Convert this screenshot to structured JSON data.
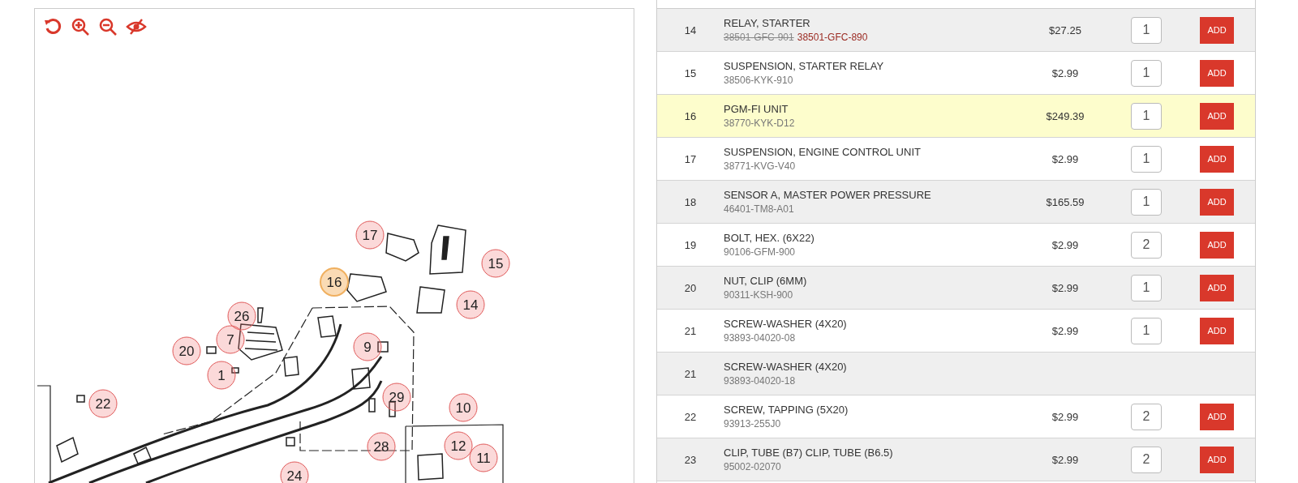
{
  "diagram": {
    "callouts": [
      {
        "label": "17",
        "selected": false
      },
      {
        "label": "15",
        "selected": false
      },
      {
        "label": "16",
        "selected": true
      },
      {
        "label": "14",
        "selected": false
      },
      {
        "label": "26",
        "selected": false
      },
      {
        "label": "7",
        "selected": false
      },
      {
        "label": "20",
        "selected": false
      },
      {
        "label": "9",
        "selected": false
      },
      {
        "label": "1",
        "selected": false
      },
      {
        "label": "22",
        "selected": false
      },
      {
        "label": "29",
        "selected": false
      },
      {
        "label": "10",
        "selected": false
      },
      {
        "label": "28",
        "selected": false
      },
      {
        "label": "12",
        "selected": false
      },
      {
        "label": "11",
        "selected": false
      },
      {
        "label": "24",
        "selected": false
      }
    ]
  },
  "parts": [
    {
      "ref": "14",
      "name": "RELAY, STARTER",
      "superseded_number": "38501-GFC-901",
      "part_number": "38501-GFC-890",
      "price": "$27.25",
      "qty": "1",
      "add": "ADD",
      "selected": false
    },
    {
      "ref": "15",
      "name": "SUSPENSION, STARTER RELAY",
      "part_number": "38506-KYK-910",
      "price": "$2.99",
      "qty": "1",
      "add": "ADD",
      "selected": false
    },
    {
      "ref": "16",
      "name": "PGM-FI UNIT",
      "part_number": "38770-KYK-D12",
      "price": "$249.39",
      "qty": "1",
      "add": "ADD",
      "selected": true
    },
    {
      "ref": "17",
      "name": "SUSPENSION, ENGINE CONTROL UNIT",
      "part_number": "38771-KVG-V40",
      "price": "$2.99",
      "qty": "1",
      "add": "ADD",
      "selected": false
    },
    {
      "ref": "18",
      "name": "SENSOR A, MASTER POWER PRESSURE",
      "part_number": "46401-TM8-A01",
      "price": "$165.59",
      "qty": "1",
      "add": "ADD",
      "selected": false
    },
    {
      "ref": "19",
      "name": "BOLT, HEX. (6X22)",
      "part_number": "90106-GFM-900",
      "price": "$2.99",
      "qty": "2",
      "add": "ADD",
      "selected": false
    },
    {
      "ref": "20",
      "name": "NUT, CLIP (6MM)",
      "part_number": "90311-KSH-900",
      "price": "$2.99",
      "qty": "1",
      "add": "ADD",
      "selected": false
    },
    {
      "ref": "21",
      "name": "SCREW-WASHER (4X20)",
      "part_number": "93893-04020-08",
      "price": "$2.99",
      "qty": "1",
      "add": "ADD",
      "selected": false
    },
    {
      "ref": "21",
      "name": "SCREW-WASHER (4X20)",
      "part_number": "93893-04020-18",
      "selected": false
    },
    {
      "ref": "22",
      "name": "SCREW, TAPPING (5X20)",
      "part_number": "93913-255J0",
      "price": "$2.99",
      "qty": "2",
      "add": "ADD",
      "selected": false
    },
    {
      "ref": "23",
      "name": "CLIP, TUBE (B7) CLIP, TUBE (B6.5)",
      "part_number": "95002-02070",
      "price": "$2.99",
      "qty": "2",
      "add": "ADD",
      "selected": false
    }
  ]
}
